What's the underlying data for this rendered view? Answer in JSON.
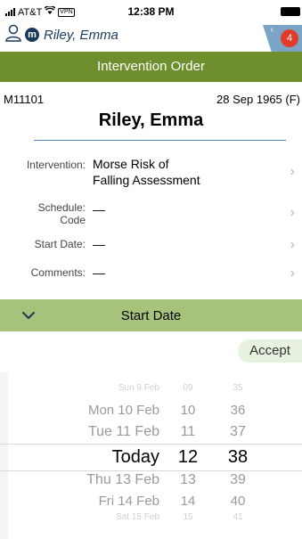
{
  "status_bar": {
    "carrier": "AT&T",
    "vpn": "VPN",
    "time": "12:38 PM"
  },
  "patient_bar": {
    "name": "Riley, Emma",
    "avatar_letter": "m",
    "notification_count": "4"
  },
  "title": "Intervention Order",
  "patient": {
    "mrn": "M11101",
    "dob": "28 Sep 1965 (F)",
    "name": "Riley, Emma"
  },
  "form": {
    "intervention": {
      "label": "Intervention:",
      "value_line1": "Morse Risk of",
      "value_line2": "Falling Assessment"
    },
    "schedule_code": {
      "label_line1": "Schedule:",
      "label_line2": "Code",
      "value": "—"
    },
    "start_date": {
      "label": "Start Date:",
      "value": "—"
    },
    "comments": {
      "label": "Comments:",
      "value": "—"
    }
  },
  "section": {
    "title": "Start Date"
  },
  "accept_label": "Accept",
  "picker": {
    "rows": [
      {
        "day": "Sun 9 Feb",
        "hour": "09",
        "minute": "35"
      },
      {
        "day": "Mon 10 Feb",
        "hour": "10",
        "minute": "36"
      },
      {
        "day": "Tue 11 Feb",
        "hour": "11",
        "minute": "37"
      },
      {
        "day": "Today",
        "hour": "12",
        "minute": "38"
      },
      {
        "day": "Thu 13 Feb",
        "hour": "13",
        "minute": "39"
      },
      {
        "day": "Fri 14 Feb",
        "hour": "14",
        "minute": "40"
      },
      {
        "day": "Sat 15 Feb",
        "hour": "15",
        "minute": "41"
      }
    ],
    "selected_index": 3
  },
  "colors": {
    "title_bar": "#6f8f2e",
    "section_bar": "#a7c27a",
    "accent_blue": "#1b3a5c",
    "badge": "#e23b2a"
  }
}
